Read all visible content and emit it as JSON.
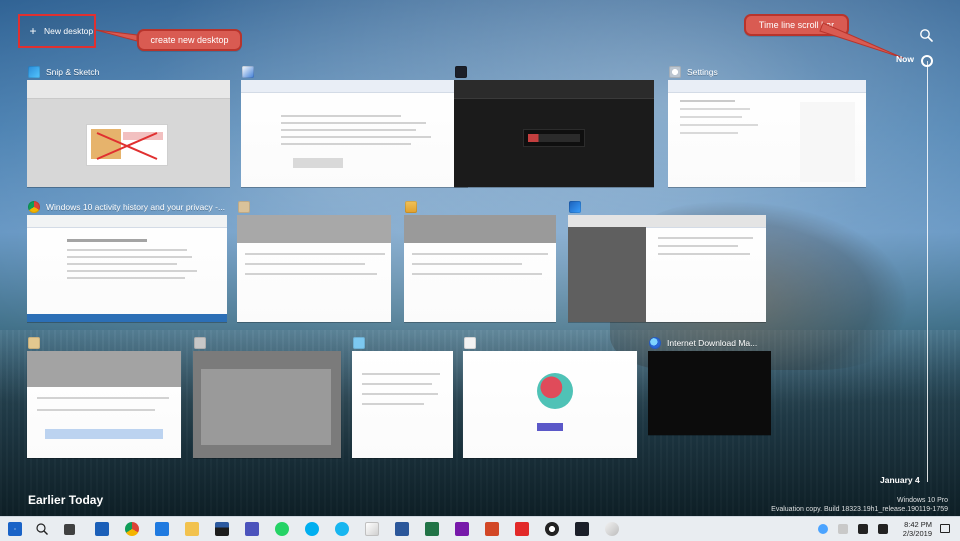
{
  "top": {
    "new_desktop_label": "New desktop",
    "callout_new_desktop": "create new desktop",
    "callout_timeline": "Time line scroll bar"
  },
  "timeline": {
    "now_label": "Now",
    "date_label": "January 4"
  },
  "section": {
    "earlier_today": "Earlier Today"
  },
  "cards": [
    {
      "id": "snip",
      "title": "Snip & Sketch",
      "icon": "snip-icon"
    },
    {
      "id": "blur1",
      "title": "",
      "icon": "app-icon"
    },
    {
      "id": "snagit",
      "title": "",
      "icon": "snagit-icon"
    },
    {
      "id": "settings",
      "title": "Settings",
      "icon": "gear-icon"
    },
    {
      "id": "chrome",
      "title": "Windows 10 activity history and your privacy -...",
      "icon": "chrome-icon"
    },
    {
      "id": "blur2",
      "title": "",
      "icon": "app-icon"
    },
    {
      "id": "mail",
      "title": "",
      "icon": "mail-icon"
    },
    {
      "id": "outlook",
      "title": "",
      "icon": "outlook-icon"
    },
    {
      "id": "blur3",
      "title": "",
      "icon": "app-icon"
    },
    {
      "id": "blur4",
      "title": "",
      "icon": "app-icon"
    },
    {
      "id": "blur5",
      "title": "",
      "icon": "app-icon"
    },
    {
      "id": "blur6",
      "title": "",
      "icon": "app-icon"
    },
    {
      "id": "idm",
      "title": "Internet Download Ma...",
      "icon": "download-icon"
    }
  ],
  "watermark": {
    "line1": "Windows 10 Pro",
    "line2": "Evaluation copy. Build 18323.19h1_release.190119-1759"
  },
  "taskbar": {
    "time": "8:42 PM",
    "date": "2/3/2019"
  }
}
